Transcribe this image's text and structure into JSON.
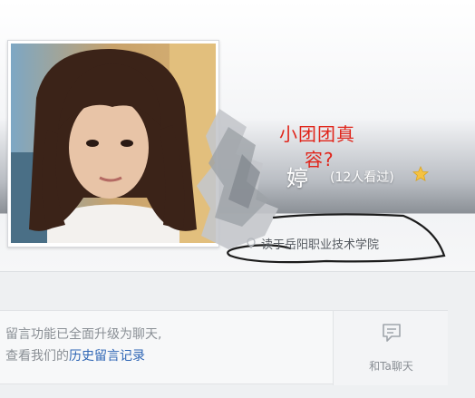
{
  "profile": {
    "name_visible_char": "婷",
    "view_count": "(12人看过)",
    "school": "读于岳阳职业技术学院",
    "star_icon": "star-icon",
    "school_icon": "location-pin-icon"
  },
  "annotation": {
    "text_line1": "小团团真",
    "text_line2": "容?",
    "color": "#e0251b"
  },
  "message_notice": {
    "text_before_link": "留言功能已全面升级为聊天,",
    "text_line2_prefix": "查看我们的",
    "link_text": "历史留言记录",
    "link_color": "#2f66b5"
  },
  "chat_button": {
    "label": "和Ta聊天",
    "icon": "chat-bubble-icon"
  }
}
